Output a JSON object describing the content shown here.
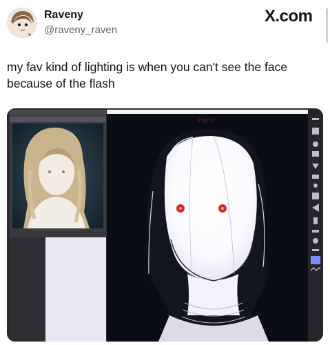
{
  "author": {
    "display_name": "Raveny",
    "handle": "@raveny_raven"
  },
  "brand": "X.com",
  "tweet": {
    "text": "my fav kind of lighting is when you can't see the face because of the flash"
  },
  "media": {
    "canvas_label": "Ingrid",
    "icons": [
      "avatar-icon",
      "reference-photo",
      "drawing-canvas",
      "tool-icons"
    ],
    "colors": {
      "canvas_bg": "#0b0d14",
      "eyes": "#d82828",
      "face_glow": "#ffffff",
      "app_chrome": "#2b2b2f"
    }
  }
}
